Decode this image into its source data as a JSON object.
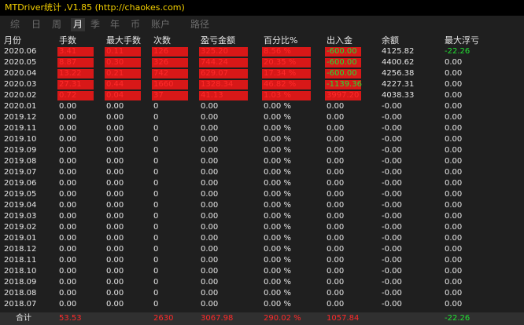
{
  "title": "MTDriver统计 ,V1.85 (http://chaokes.com)",
  "tabs": [
    {
      "label": "综"
    },
    {
      "label": "日"
    },
    {
      "label": "周"
    },
    {
      "label": "月"
    },
    {
      "label": "季"
    },
    {
      "label": "年"
    },
    {
      "label": "币"
    },
    {
      "label": "账户"
    },
    {
      "label": "路径"
    }
  ],
  "columns": [
    "月份",
    "手数",
    "最大手数",
    "次数",
    "盈亏金额",
    "百分比%",
    "出入金",
    "余额",
    "最大浮亏"
  ],
  "rows": [
    [
      "2020.06",
      "3.41",
      "0.11",
      "126",
      "325.20",
      "8.56 %",
      "-600.00",
      "4125.82",
      "-22.26"
    ],
    [
      "2020.05",
      "8.87",
      "0.30",
      "326",
      "744.24",
      "20.35 %",
      "-600.00",
      "4400.62",
      "0.00"
    ],
    [
      "2020.04",
      "13.22",
      "0.21",
      "742",
      "629.07",
      "17.34 %",
      "-600.00",
      "4256.38",
      "0.00"
    ],
    [
      "2020.03",
      "27.31",
      "0.44",
      "1660",
      "1328.34",
      "46.82 %",
      "-1139.36",
      "4227.31",
      "0.00"
    ],
    [
      "2020.02",
      "0.72",
      "0.04",
      "37",
      "41.13",
      "1.03 %",
      "3997.20",
      "4038.33",
      "0.00"
    ],
    [
      "2020.01",
      "0.00",
      "0.00",
      "0",
      "0.00",
      "0.00 %",
      "0.00",
      "-0.00",
      "0.00"
    ],
    [
      "2019.12",
      "0.00",
      "0.00",
      "0",
      "0.00",
      "0.00 %",
      "0.00",
      "-0.00",
      "0.00"
    ],
    [
      "2019.11",
      "0.00",
      "0.00",
      "0",
      "0.00",
      "0.00 %",
      "0.00",
      "-0.00",
      "0.00"
    ],
    [
      "2019.10",
      "0.00",
      "0.00",
      "0",
      "0.00",
      "0.00 %",
      "0.00",
      "-0.00",
      "0.00"
    ],
    [
      "2019.09",
      "0.00",
      "0.00",
      "0",
      "0.00",
      "0.00 %",
      "0.00",
      "-0.00",
      "0.00"
    ],
    [
      "2019.08",
      "0.00",
      "0.00",
      "0",
      "0.00",
      "0.00 %",
      "0.00",
      "-0.00",
      "0.00"
    ],
    [
      "2019.07",
      "0.00",
      "0.00",
      "0",
      "0.00",
      "0.00 %",
      "0.00",
      "-0.00",
      "0.00"
    ],
    [
      "2019.06",
      "0.00",
      "0.00",
      "0",
      "0.00",
      "0.00 %",
      "0.00",
      "-0.00",
      "0.00"
    ],
    [
      "2019.05",
      "0.00",
      "0.00",
      "0",
      "0.00",
      "0.00 %",
      "0.00",
      "-0.00",
      "0.00"
    ],
    [
      "2019.04",
      "0.00",
      "0.00",
      "0",
      "0.00",
      "0.00 %",
      "0.00",
      "-0.00",
      "0.00"
    ],
    [
      "2019.03",
      "0.00",
      "0.00",
      "0",
      "0.00",
      "0.00 %",
      "0.00",
      "-0.00",
      "0.00"
    ],
    [
      "2019.02",
      "0.00",
      "0.00",
      "0",
      "0.00",
      "0.00 %",
      "0.00",
      "-0.00",
      "0.00"
    ],
    [
      "2019.01",
      "0.00",
      "0.00",
      "0",
      "0.00",
      "0.00 %",
      "0.00",
      "-0.00",
      "0.00"
    ],
    [
      "2018.12",
      "0.00",
      "0.00",
      "0",
      "0.00",
      "0.00 %",
      "0.00",
      "-0.00",
      "0.00"
    ],
    [
      "2018.11",
      "0.00",
      "0.00",
      "0",
      "0.00",
      "0.00 %",
      "0.00",
      "-0.00",
      "0.00"
    ],
    [
      "2018.10",
      "0.00",
      "0.00",
      "0",
      "0.00",
      "0.00 %",
      "0.00",
      "-0.00",
      "0.00"
    ],
    [
      "2018.09",
      "0.00",
      "0.00",
      "0",
      "0.00",
      "0.00 %",
      "0.00",
      "-0.00",
      "0.00"
    ],
    [
      "2018.08",
      "0.00",
      "0.00",
      "0",
      "0.00",
      "0.00 %",
      "0.00",
      "-0.00",
      "0.00"
    ],
    [
      "2018.07",
      "0.00",
      "0.00",
      "0",
      "0.00",
      "0.00 %",
      "0.00",
      "-0.00",
      "0.00"
    ]
  ],
  "footer": {
    "label": "合计",
    "lots": "53.53",
    "max_lots": "",
    "trades": "2630",
    "pnl": "3067.98",
    "percent": "290.02 %",
    "inout": "1057.84",
    "balance": "",
    "max_float_loss": "-22.26"
  },
  "colors": {
    "title": "#f5d000",
    "positive": "#ff2a2a",
    "negative": "#22e033",
    "highlight_bg": "#d81818",
    "background": "#1f1f1f"
  }
}
